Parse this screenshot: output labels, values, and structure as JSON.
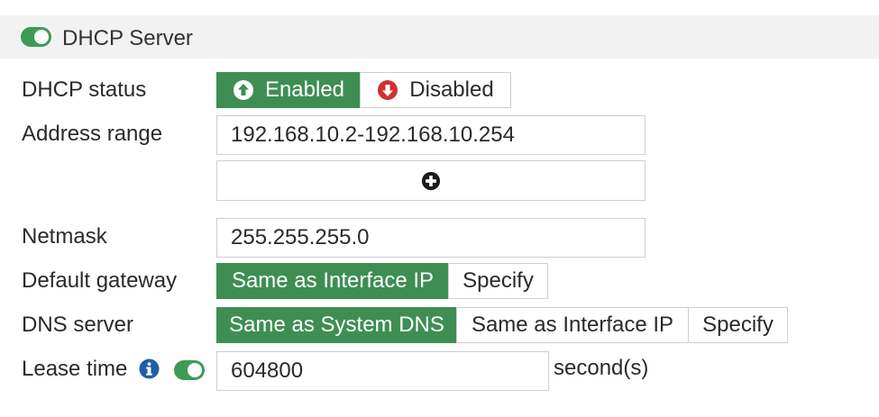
{
  "header": {
    "title": "DHCP Server",
    "toggle_on": true,
    "toggle_icon": "toggle-on-icon"
  },
  "colors": {
    "accent_green": "#3e8e54",
    "toggle_green": "#3e9b57",
    "disabled_red": "#d32f2f",
    "info_blue": "#1f5fa8"
  },
  "dhcp_status": {
    "label": "DHCP status",
    "options": [
      {
        "label": "Enabled",
        "icon": "arrow-up-circle-icon",
        "selected": true
      },
      {
        "label": "Disabled",
        "icon": "arrow-down-circle-icon",
        "selected": false
      }
    ]
  },
  "address_range": {
    "label": "Address range",
    "value": "192.168.10.2-192.168.10.254",
    "add_icon": "plus-circle-icon"
  },
  "netmask": {
    "label": "Netmask",
    "value": "255.255.255.0"
  },
  "default_gateway": {
    "label": "Default gateway",
    "options": [
      {
        "label": "Same as Interface IP",
        "selected": true
      },
      {
        "label": "Specify",
        "selected": false
      }
    ]
  },
  "dns_server": {
    "label": "DNS server",
    "options": [
      {
        "label": "Same as System DNS",
        "selected": true
      },
      {
        "label": "Same as Interface IP",
        "selected": false
      },
      {
        "label": "Specify",
        "selected": false
      }
    ]
  },
  "lease_time": {
    "label": "Lease time",
    "info_icon": "info-icon",
    "toggle_on": true,
    "value": "604800",
    "unit": "second(s)"
  }
}
